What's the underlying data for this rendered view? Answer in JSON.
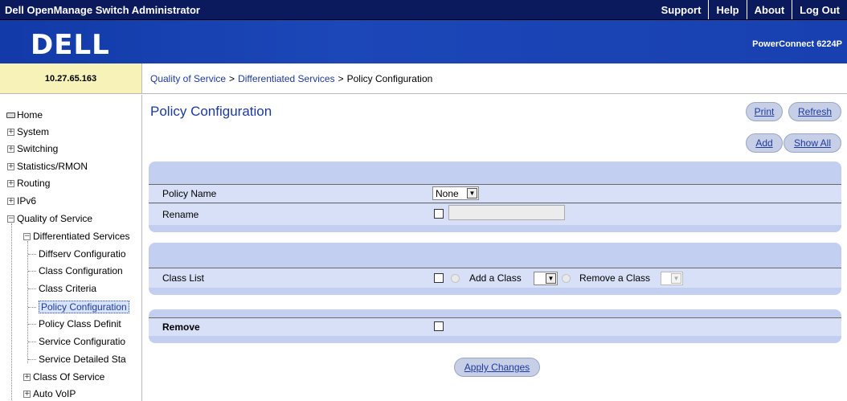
{
  "header": {
    "app_title": "Dell OpenManage Switch Administrator",
    "links": [
      "Support",
      "Help",
      "About",
      "Log Out"
    ]
  },
  "banner": {
    "logo_text": "D©LL",
    "model": "PowerConnect 6224P"
  },
  "device_ip": "10.27.65.163",
  "breadcrumb": {
    "items": [
      "Quality of Service",
      "Differentiated Services",
      "Policy Configuration"
    ],
    "separator": ">"
  },
  "sidebar": {
    "items": [
      "Home",
      "System",
      "Switching",
      "Statistics/RMON",
      "Routing",
      "IPv6",
      "Quality of Service",
      "Differentiated Services",
      "Diffserv Configuratio",
      "Class Configuration",
      "Class Criteria",
      "Policy Configuration",
      "Policy Class Definit",
      "Service Configuratio",
      "Service Detailed Sta",
      "Class Of Service",
      "Auto VoIP"
    ]
  },
  "page": {
    "title": "Policy Configuration",
    "buttons": {
      "print": "Print",
      "refresh": "Refresh",
      "add": "Add",
      "show_all": "Show All",
      "apply": "Apply Changes"
    }
  },
  "form": {
    "policy_name_label": "Policy Name",
    "policy_name_value": "None",
    "rename_label": "Rename",
    "rename_value": "",
    "class_list_label": "Class List",
    "add_class_label": "Add a Class",
    "remove_class_label": "Remove a Class",
    "remove_label": "Remove"
  },
  "colors": {
    "top_bar": "#0a1a5c",
    "banner": "#1840b0",
    "panel": "#c3cff0",
    "link": "#1d3a9e"
  }
}
